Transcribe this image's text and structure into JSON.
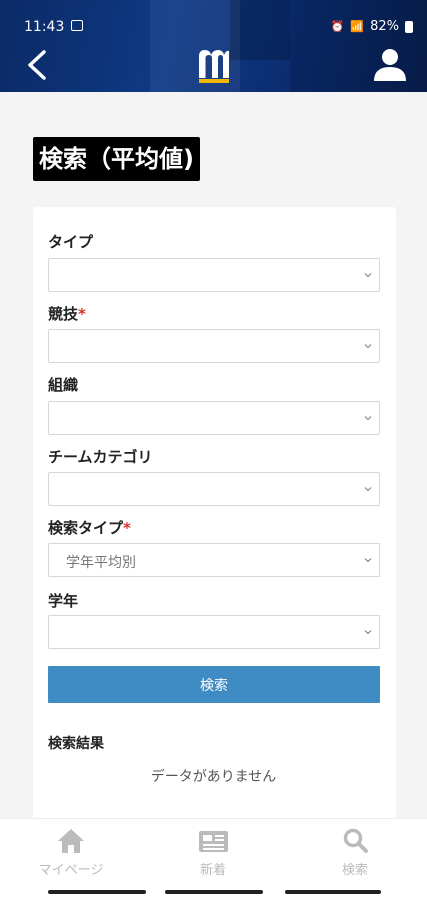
{
  "status_bar": {
    "time": "11:43",
    "battery": "82%"
  },
  "header": {
    "logo": "m-logo-icon"
  },
  "page": {
    "title": "検索（平均値)"
  },
  "form": {
    "fields": [
      {
        "label": "タイプ",
        "required": false,
        "value": ""
      },
      {
        "label": "競技",
        "required": true,
        "value": ""
      },
      {
        "label": "組織",
        "required": false,
        "value": ""
      },
      {
        "label": "チームカテゴリ",
        "required": false,
        "value": ""
      },
      {
        "label": "検索タイプ",
        "required": true,
        "value": "学年平均別"
      },
      {
        "label": "学年",
        "required": false,
        "value": ""
      }
    ],
    "required_mark": "*",
    "search_button": "検索"
  },
  "results": {
    "label": "検索結果",
    "empty_text": "データがありません"
  },
  "bottom_nav": {
    "items": [
      {
        "label": "マイページ",
        "icon": "home-icon"
      },
      {
        "label": "新着",
        "icon": "news-icon"
      },
      {
        "label": "検索",
        "icon": "search-icon"
      }
    ]
  },
  "colors": {
    "header": "#0e3a86",
    "button": "#3f8bc3",
    "required": "#d9302c"
  }
}
